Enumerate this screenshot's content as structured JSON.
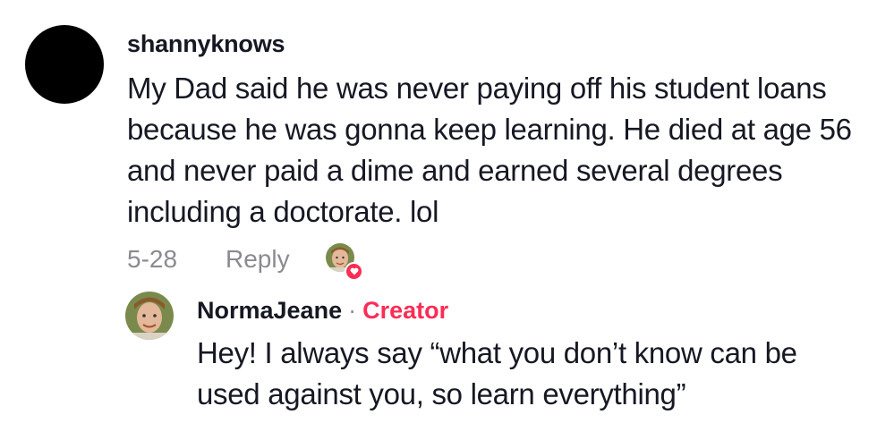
{
  "comment": {
    "username": "shannyknows",
    "text": "My Dad said he was never paying off his student loans because he was gonna keep learning. He died at age 56 and never paid a dime and earned several degrees including a doctorate. lol",
    "date": "5-28",
    "reply_label": "Reply",
    "avatar_color": "#000000",
    "creator_liked": true
  },
  "reply": {
    "username": "NormaJeane",
    "separator": "·",
    "badge": "Creator",
    "badge_color": "#fe2c55",
    "text": "Hey! I always say “what you don’t know can be used against you, so learn everything”"
  },
  "colors": {
    "text": "#161823",
    "muted": "#8a8b91",
    "accent": "#fe2c55"
  }
}
